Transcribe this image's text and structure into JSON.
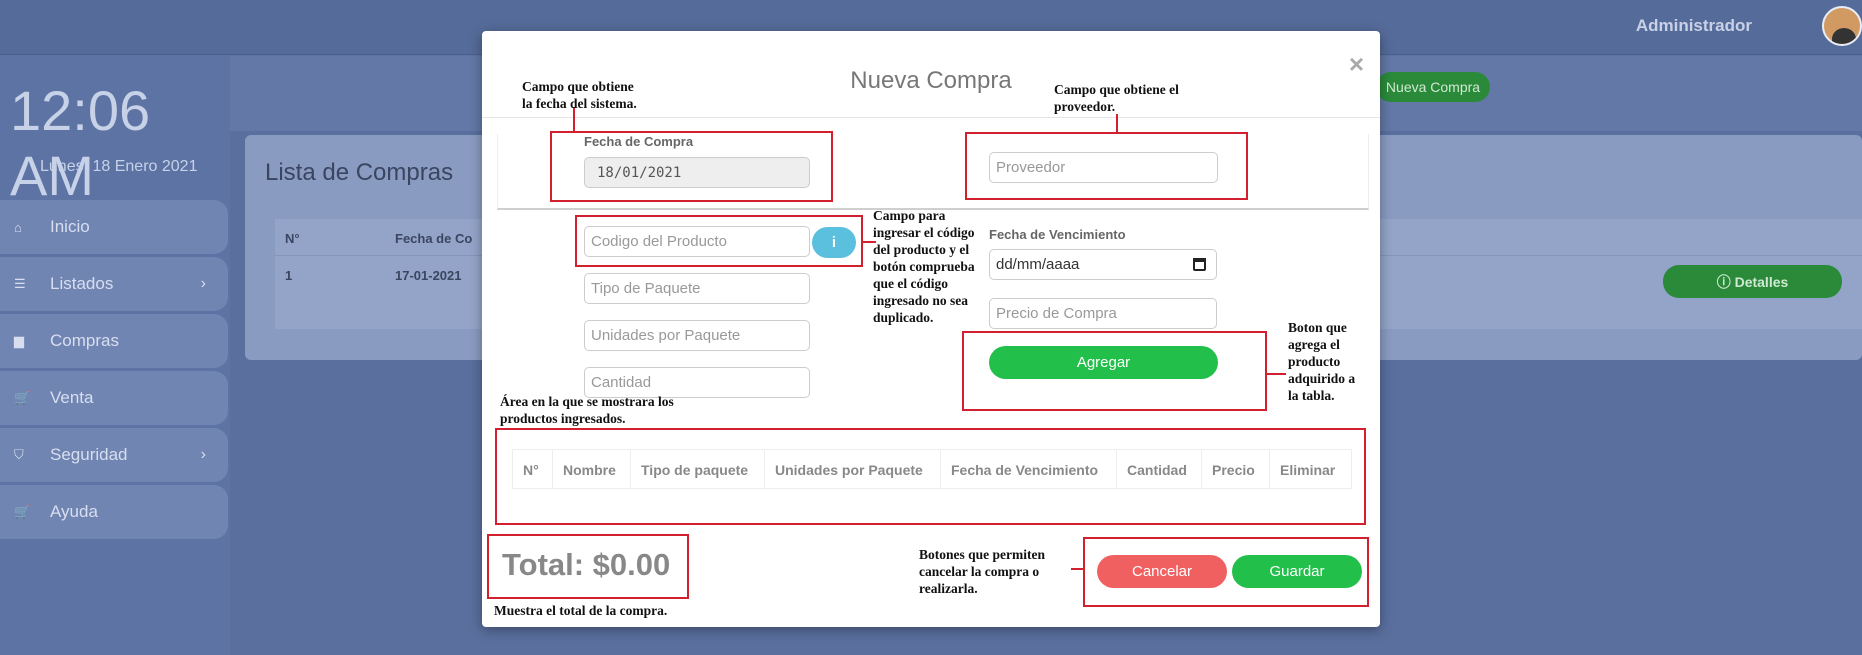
{
  "topbar": {
    "user_name": "Administrador"
  },
  "sidebar": {
    "clock": "12:06 AM",
    "date": "Lunes, 18 Enero 2021",
    "items": [
      {
        "label": "Inicio",
        "icon": "home-icon",
        "glyph": "⌂",
        "has_chevron": false
      },
      {
        "label": "Listados",
        "icon": "list-icon",
        "glyph": "☰",
        "has_chevron": true
      },
      {
        "label": "Compras",
        "icon": "briefcase-icon",
        "glyph": "▆",
        "has_chevron": false
      },
      {
        "label": "Venta",
        "icon": "cart-icon",
        "glyph": "🛒",
        "has_chevron": false
      },
      {
        "label": "Seguridad",
        "icon": "shield-icon",
        "glyph": "⛉",
        "has_chevron": true
      },
      {
        "label": "Ayuda",
        "icon": "cart-icon",
        "glyph": "🛒",
        "has_chevron": false
      }
    ],
    "chevron": "›"
  },
  "main": {
    "new_purchase_button": "Nueva Compra",
    "list_title": "Lista de Compras",
    "table_headers": [
      "N°",
      "Fecha de Co"
    ],
    "rows": [
      {
        "num": "1",
        "date": "17-01-2021"
      }
    ],
    "details_button": "ⓘ Detalles"
  },
  "modal": {
    "title": "Nueva Compra",
    "close": "×",
    "fecha_label": "Fecha de Compra",
    "fecha_value": "18/01/2021",
    "proveedor_placeholder": "Proveedor",
    "codigo_placeholder": "Codigo del Producto",
    "info_button": "i",
    "tipo_paquete_placeholder": "Tipo de Paquete",
    "unidades_placeholder": "Unidades por Paquete",
    "cantidad_placeholder": "Cantidad",
    "vencimiento_label": "Fecha de Vencimiento",
    "vencimiento_value": "dd/mm/aaaa",
    "precio_placeholder": "Precio de Compra",
    "agregar_button": "Agregar",
    "table_headers": [
      "N°",
      "Nombre",
      "Tipo de paquete",
      "Unidades por Paquete",
      "Fecha de Vencimiento",
      "Cantidad",
      "Precio",
      "Eliminar"
    ],
    "total": "Total: $0.00",
    "cancel_button": "Cancelar",
    "save_button": "Guardar"
  },
  "annotations": {
    "fecha": "Campo que obtiene\nla fecha del sistema.",
    "proveedor": "Campo que obtiene el\nproveedor.",
    "codigo": "Campo para\ningresar el código\ndel producto y el\nbotón comprueba\nque el código\ningresado no sea\nduplicado.",
    "agregar": "Boton que\nagrega el\nproducto\nadquirido a\nla tabla.",
    "area": "Área en la que se mostrara los\nproductos ingresados.",
    "botones": "Botones que permiten\ncancelar la compra o\nrealizarla.",
    "total": "Muestra el total de la compra."
  },
  "colors": {
    "annotation_red": "#d3202e",
    "success_green": "#22bf4a",
    "cancel_red": "#f16060",
    "info_blue": "#5bc0de"
  }
}
